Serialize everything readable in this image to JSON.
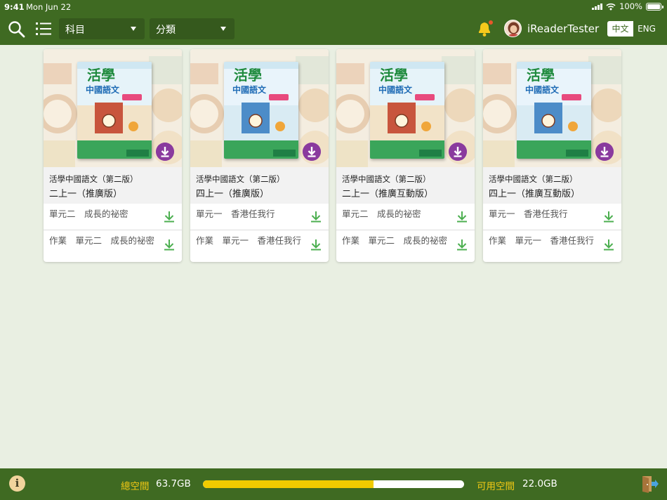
{
  "status_bar": {
    "time": "9:41",
    "date": "Mon Jun 22",
    "battery": "100%"
  },
  "header": {
    "subject_dropdown": "科目",
    "category_dropdown": "分類",
    "username": "iReaderTester",
    "lang_zh": "中文",
    "lang_en": "ENG",
    "icons": {
      "search": "search-icon",
      "list": "list-icon",
      "bell": "bell-icon"
    }
  },
  "cards": [
    {
      "series": "活學中國語文（第二版）",
      "edition": "二上一（推廣版）",
      "row1": "單元二　成長的祕密",
      "row2": "作業　單元二　成長的祕密"
    },
    {
      "series": "活學中國語文（第二版）",
      "edition": "四上一（推廣版）",
      "row1": "單元一　香港任我行",
      "row2": "作業　單元一　香港任我行"
    },
    {
      "series": "活學中國語文（第二版）",
      "edition": "二上一（推廣互動版）",
      "row1": "單元二　成長的祕密",
      "row2": "作業　單元二　成長的祕密"
    },
    {
      "series": "活學中國語文（第二版）",
      "edition": "四上一（推廣互動版）",
      "row1": "單元一　香港任我行",
      "row2": "作業　單元一　香港任我行"
    }
  ],
  "footer": {
    "total_label": "總空間",
    "total_value": "63.7GB",
    "free_label": "可用空間",
    "free_value": "22.0GB",
    "used_fraction": 0.654
  },
  "colors": {
    "header": "#3f6a22",
    "accent_yellow": "#f1cb00",
    "download_green": "#4caf50",
    "badge_purple": "#8a3a9e"
  }
}
